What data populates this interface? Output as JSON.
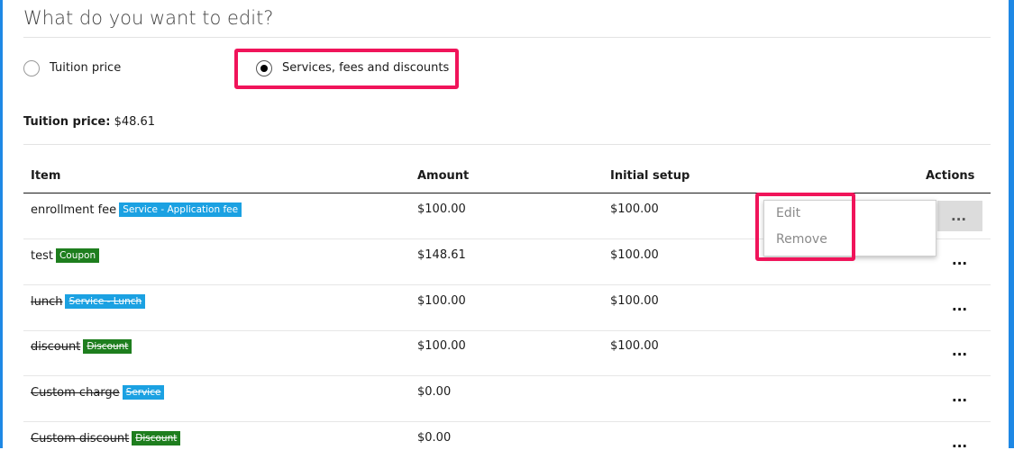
{
  "title": "What do you want to edit?",
  "options": {
    "tuition_label": "Tuition price",
    "services_label": "Services, fees and discounts",
    "selected": "services"
  },
  "tuition_price": {
    "label": "Tuition price:",
    "value": "$48.61"
  },
  "table": {
    "headers": {
      "item": "Item",
      "amount": "Amount",
      "initial_setup": "Initial setup",
      "actions": "Actions"
    },
    "rows": [
      {
        "name": "enrollment fee",
        "badge": "Service - Application fee",
        "amount": "$100.00",
        "setup": "$100.00"
      },
      {
        "name": "test",
        "badge": "Coupon",
        "amount": "$148.61",
        "setup": "$100.00"
      },
      {
        "name": "lunch",
        "badge": "Service - Lunch",
        "amount": "$100.00",
        "setup": "$100.00"
      },
      {
        "name": "discount",
        "badge": "Discount",
        "amount": "$100.00",
        "setup": "$100.00"
      },
      {
        "name": "Custom charge",
        "badge": "Service",
        "amount": "$0.00",
        "setup": ""
      },
      {
        "name": "Custom discount",
        "badge": "Discount",
        "amount": "$0.00",
        "setup": ""
      }
    ],
    "actions_glyph": "..."
  },
  "context_menu": {
    "edit_label": "Edit",
    "remove_label": "Remove"
  },
  "colors": {
    "frame": "#1e88e5",
    "highlight": "#f0145a",
    "service_badge": "#1ba1e2",
    "green_badge": "#1e7e1e"
  }
}
